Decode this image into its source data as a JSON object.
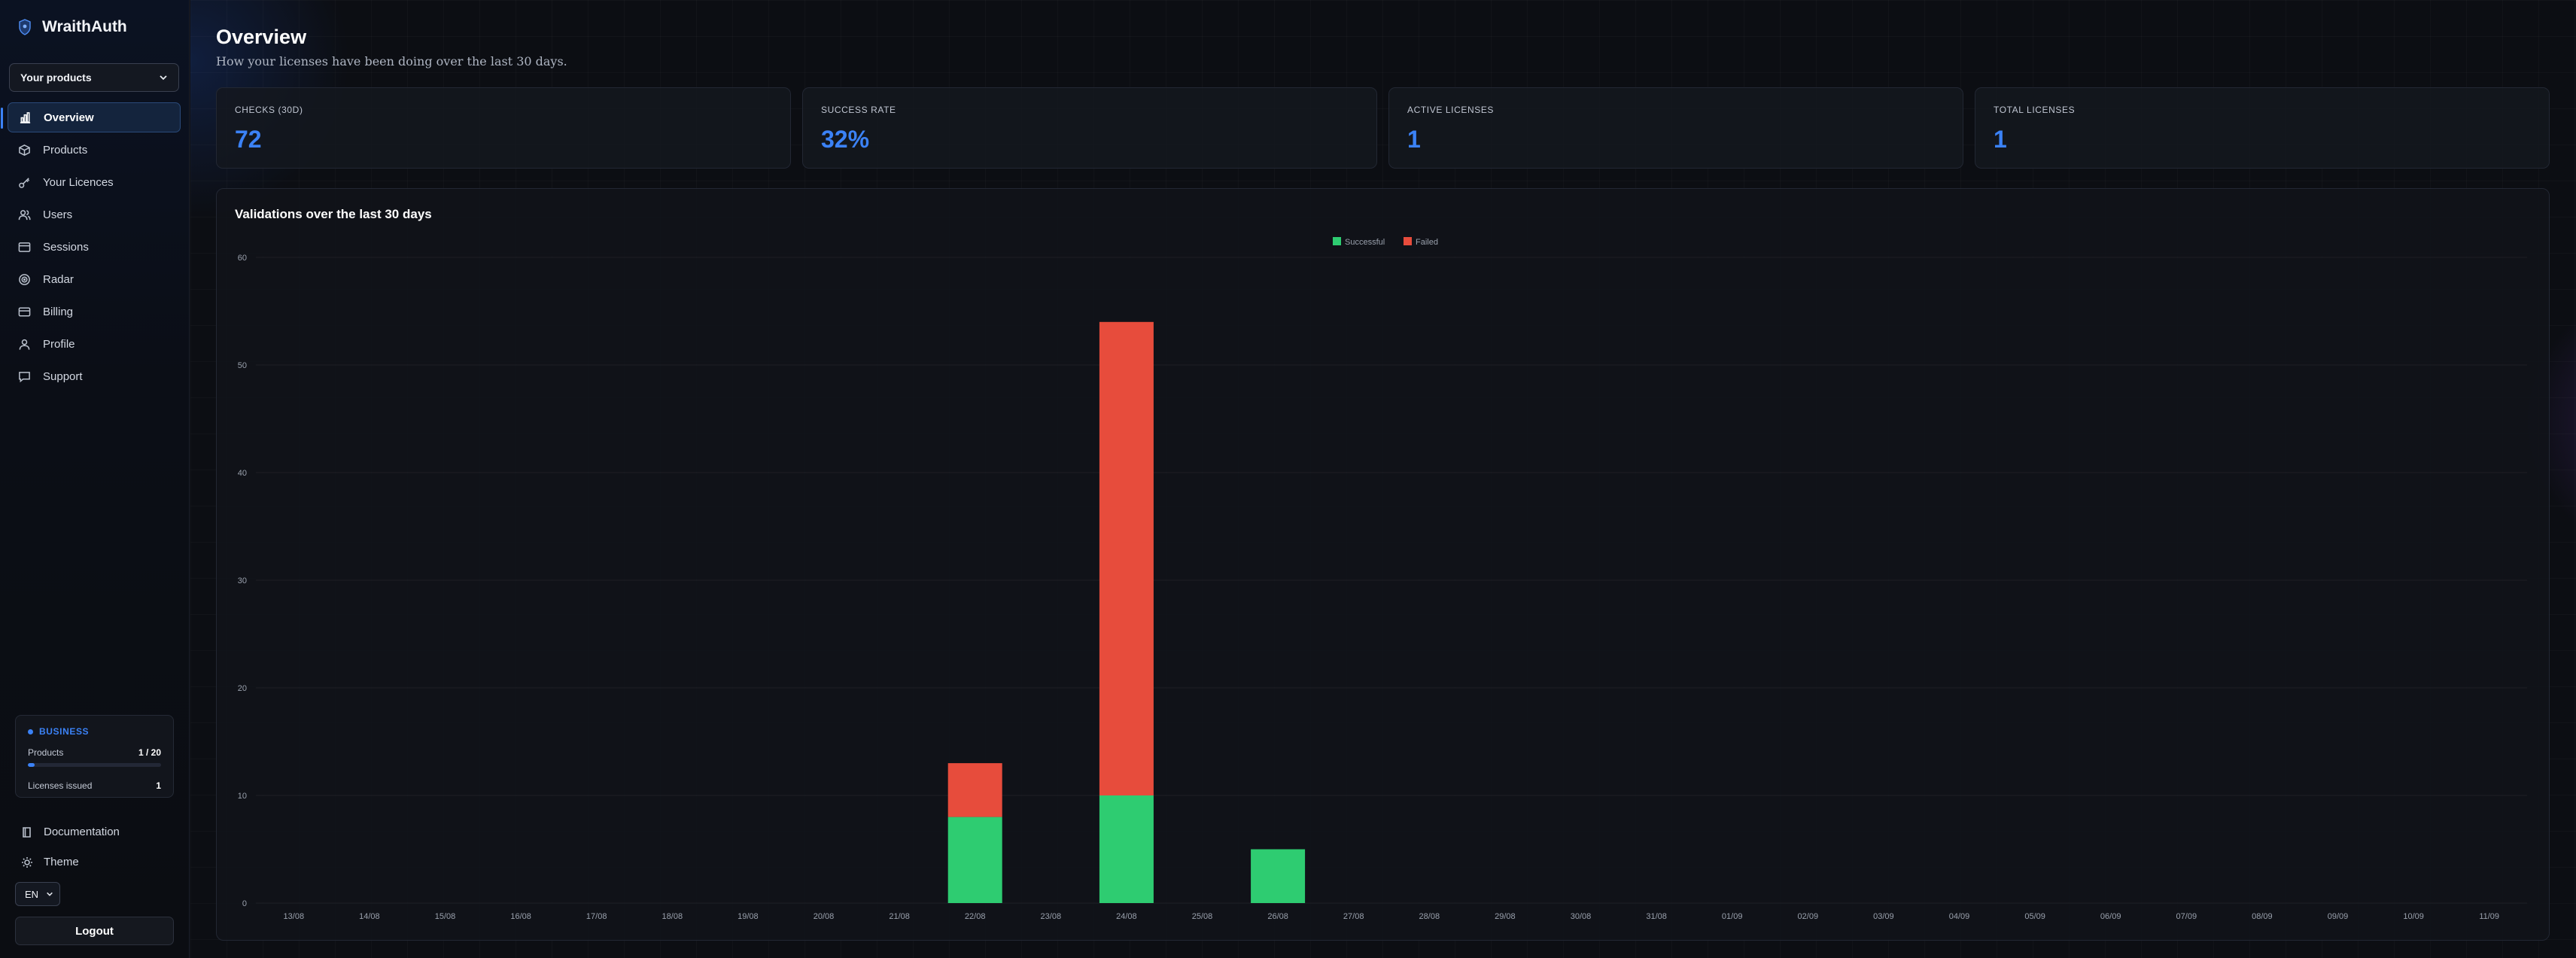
{
  "app": {
    "name": "WraithAuth"
  },
  "sidebar": {
    "product_select": "Your products",
    "items": [
      {
        "label": "Overview",
        "icon": "chart-icon"
      },
      {
        "label": "Products",
        "icon": "box-icon"
      },
      {
        "label": "Your Licences",
        "icon": "key-icon"
      },
      {
        "label": "Users",
        "icon": "users-icon"
      },
      {
        "label": "Sessions",
        "icon": "window-icon"
      },
      {
        "label": "Radar",
        "icon": "radar-icon"
      },
      {
        "label": "Billing",
        "icon": "card-icon"
      },
      {
        "label": "Profile",
        "icon": "user-icon"
      },
      {
        "label": "Support",
        "icon": "chat-icon"
      }
    ],
    "plan": {
      "name": "BUSINESS",
      "products_label": "Products",
      "products_value": "1 / 20",
      "products_fraction": 0.05,
      "licenses_label": "Licenses issued",
      "licenses_value": "1"
    },
    "documentation": "Documentation",
    "theme": "Theme",
    "language": "EN",
    "logout": "Logout"
  },
  "main": {
    "title": "Overview",
    "subtitle": "How your licenses have been doing over the last 30 days.",
    "stats": [
      {
        "label": "CHECKS (30D)",
        "value": "72"
      },
      {
        "label": "SUCCESS RATE",
        "value": "32%"
      },
      {
        "label": "ACTIVE LICENSES",
        "value": "1"
      },
      {
        "label": "TOTAL LICENSES",
        "value": "1"
      }
    ]
  },
  "colors": {
    "accent": "#3b82f6",
    "success": "#2ecc71",
    "failed": "#e74c3c"
  },
  "chart_data": {
    "type": "bar",
    "stacked": true,
    "title": "Validations over the last 30 days",
    "legend_position": "top-center",
    "ylim": [
      0,
      60
    ],
    "yticks": [
      0,
      10,
      20,
      30,
      40,
      50,
      60
    ],
    "grid": true,
    "categories": [
      "13/08",
      "14/08",
      "15/08",
      "16/08",
      "17/08",
      "18/08",
      "19/08",
      "20/08",
      "21/08",
      "22/08",
      "23/08",
      "24/08",
      "25/08",
      "26/08",
      "27/08",
      "28/08",
      "29/08",
      "30/08",
      "31/08",
      "01/09",
      "02/09",
      "03/09",
      "04/09",
      "05/09",
      "06/09",
      "07/09",
      "08/09",
      "09/09",
      "10/09",
      "11/09"
    ],
    "series": [
      {
        "name": "Successful",
        "color": "#2ecc71",
        "values": [
          0,
          0,
          0,
          0,
          0,
          0,
          0,
          0,
          0,
          8,
          0,
          10,
          0,
          5,
          0,
          0,
          0,
          0,
          0,
          0,
          0,
          0,
          0,
          0,
          0,
          0,
          0,
          0,
          0,
          0
        ]
      },
      {
        "name": "Failed",
        "color": "#e74c3c",
        "values": [
          0,
          0,
          0,
          0,
          0,
          0,
          0,
          0,
          0,
          5,
          0,
          44,
          0,
          0,
          0,
          0,
          0,
          0,
          0,
          0,
          0,
          0,
          0,
          0,
          0,
          0,
          0,
          0,
          0,
          0
        ]
      }
    ]
  }
}
